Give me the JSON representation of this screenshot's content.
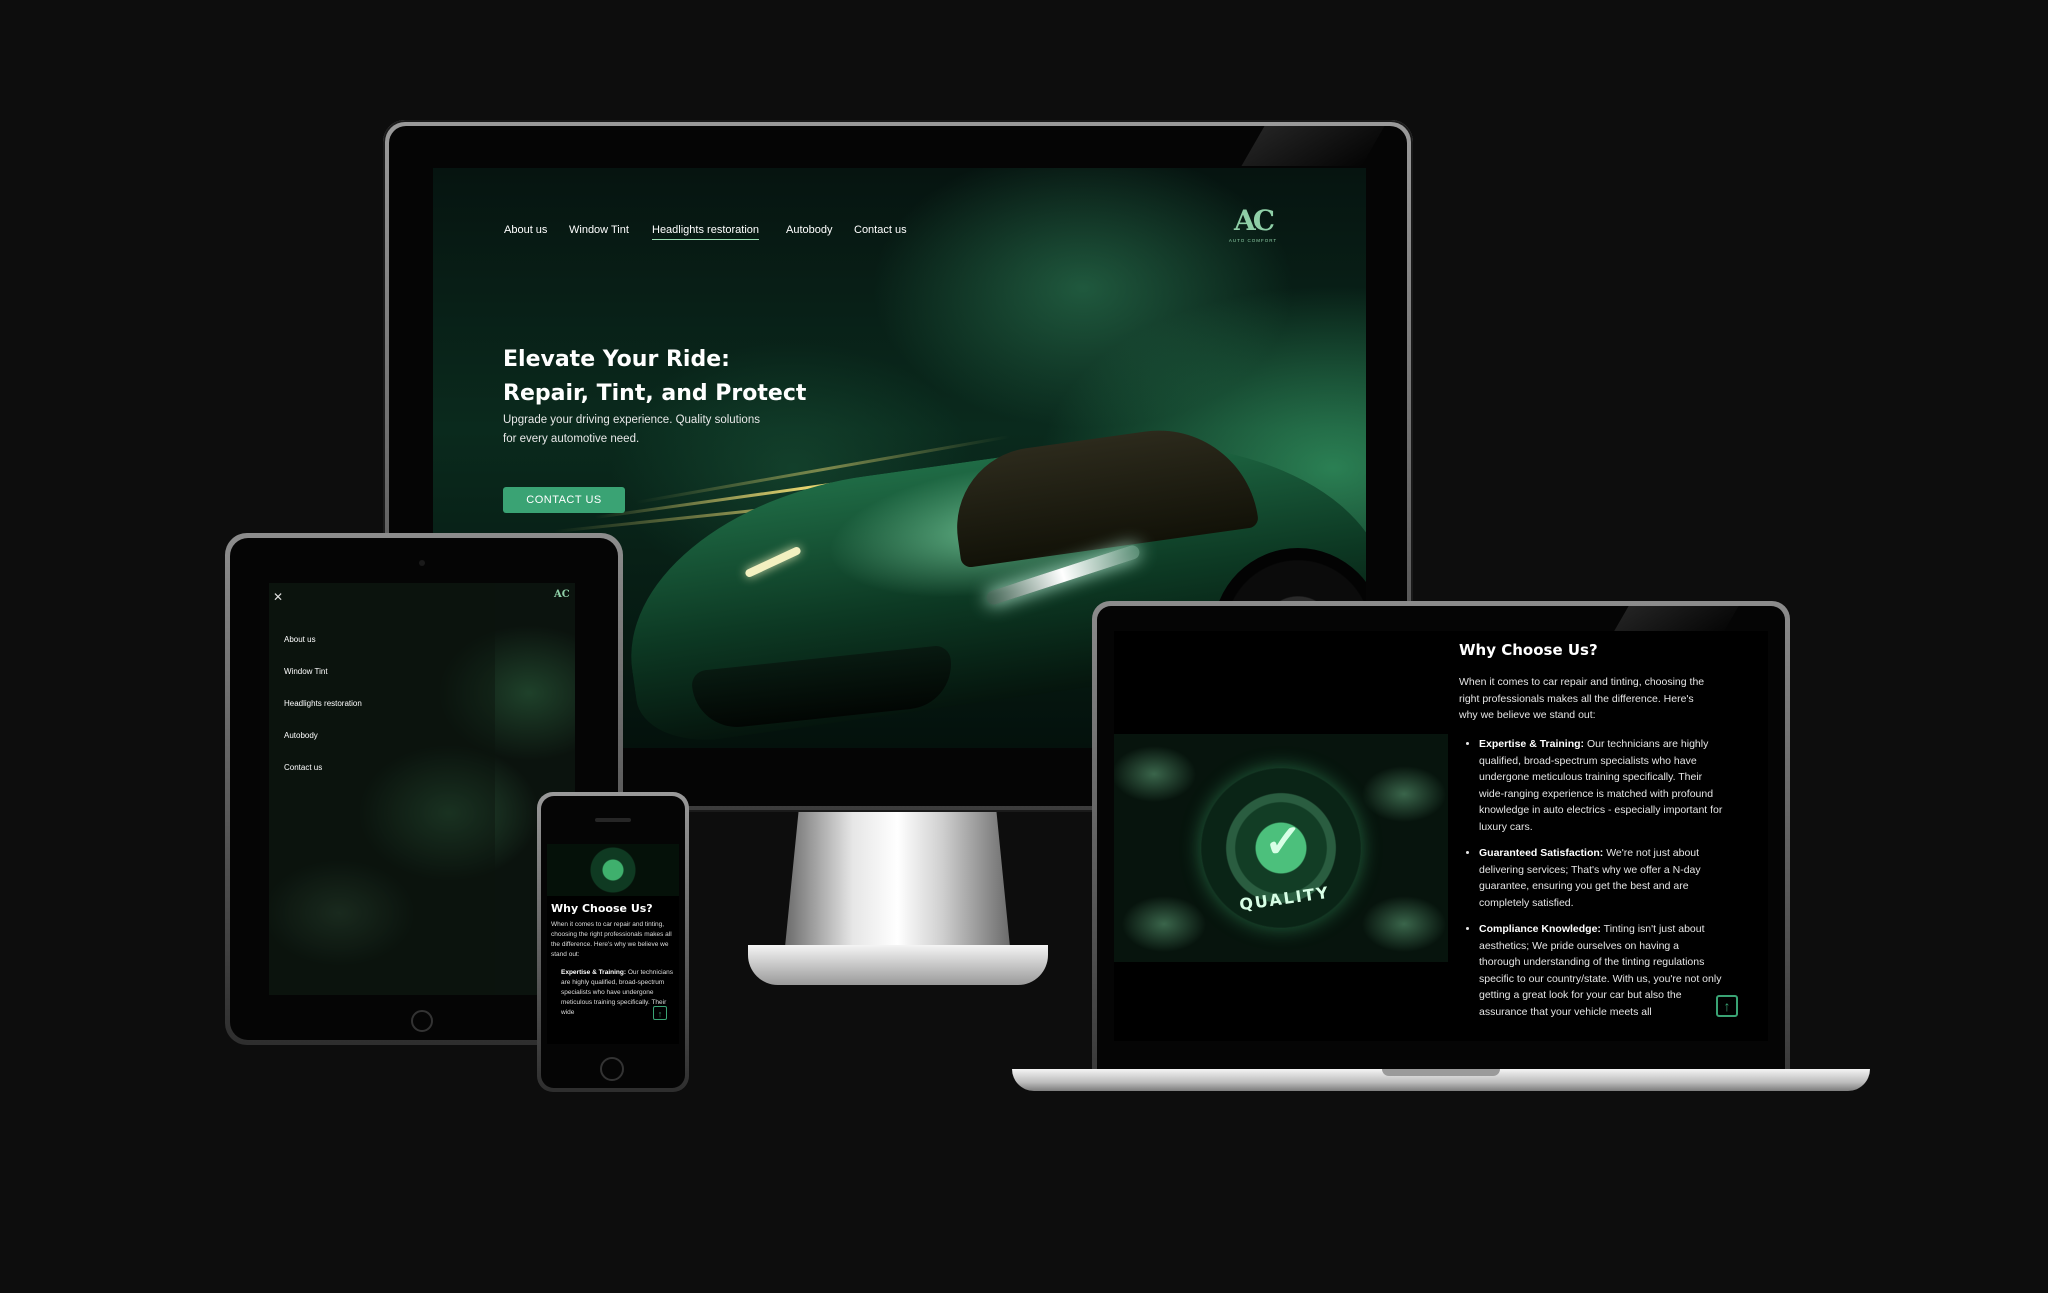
{
  "nav": {
    "items": [
      {
        "label": "About us"
      },
      {
        "label": "Window Tint"
      },
      {
        "label": "Headlights restoration"
      },
      {
        "label": "Autobody"
      },
      {
        "label": "Contact us"
      }
    ],
    "active_index": 2
  },
  "brand": {
    "logo_letters": "AC",
    "logo_tagline": "AUTO COMFORT"
  },
  "hero": {
    "title_line1": "Elevate Your Ride:",
    "title_line2": "Repair, Tint, and Protect",
    "subtitle_line1": "Upgrade your driving experience. Quality solutions",
    "subtitle_line2": "for every automotive need.",
    "cta_label": "CONTACT US"
  },
  "tablet_menu": {
    "close_icon": "close-icon",
    "items": [
      "About us",
      "Window Tint",
      "Headlights restoration",
      "Autobody",
      "Contact us"
    ]
  },
  "why": {
    "title": "Why Choose Us?",
    "intro": "When it comes to car repair and tinting, choosing the right professionals makes all the difference. Here's why we believe we stand out:",
    "points": [
      {
        "heading": "Expertise & Training:",
        "text": " Our technicians are highly qualified, broad-spectrum specialists who have undergone meticulous training specifically. Their wide-ranging experience is matched with profound knowledge in auto electrics - especially important for luxury cars."
      },
      {
        "heading": "Guaranteed Satisfaction:",
        "text": " We're not just about delivering services; That's why we offer a N-day guarantee, ensuring you get the best and are completely satisfied."
      },
      {
        "heading": "Compliance Knowledge:",
        "text": " Tinting isn't just about aesthetics; We pride ourselves on having a thorough understanding of the tinting regulations specific to our country/state. With us, you're not only getting a great look for your car but also the assurance that your vehicle meets all"
      }
    ],
    "badge_text": "QUALITY",
    "back_to_top_icon": "arrow-up-icon"
  },
  "phone": {
    "title": "Why Choose Us?",
    "intro": "When it comes to car repair and tinting, choosing the right professionals makes all the difference. Here's why we believe we stand out:",
    "point_heading": "Expertise & Training:",
    "point_text": " Our technicians are highly qualified, broad-spectrum specialists who have undergone meticulous training specifically. Their wide"
  },
  "colors": {
    "background": "#0d0d0d",
    "accent": "#3aa374",
    "accent_light": "#9be0b4"
  }
}
